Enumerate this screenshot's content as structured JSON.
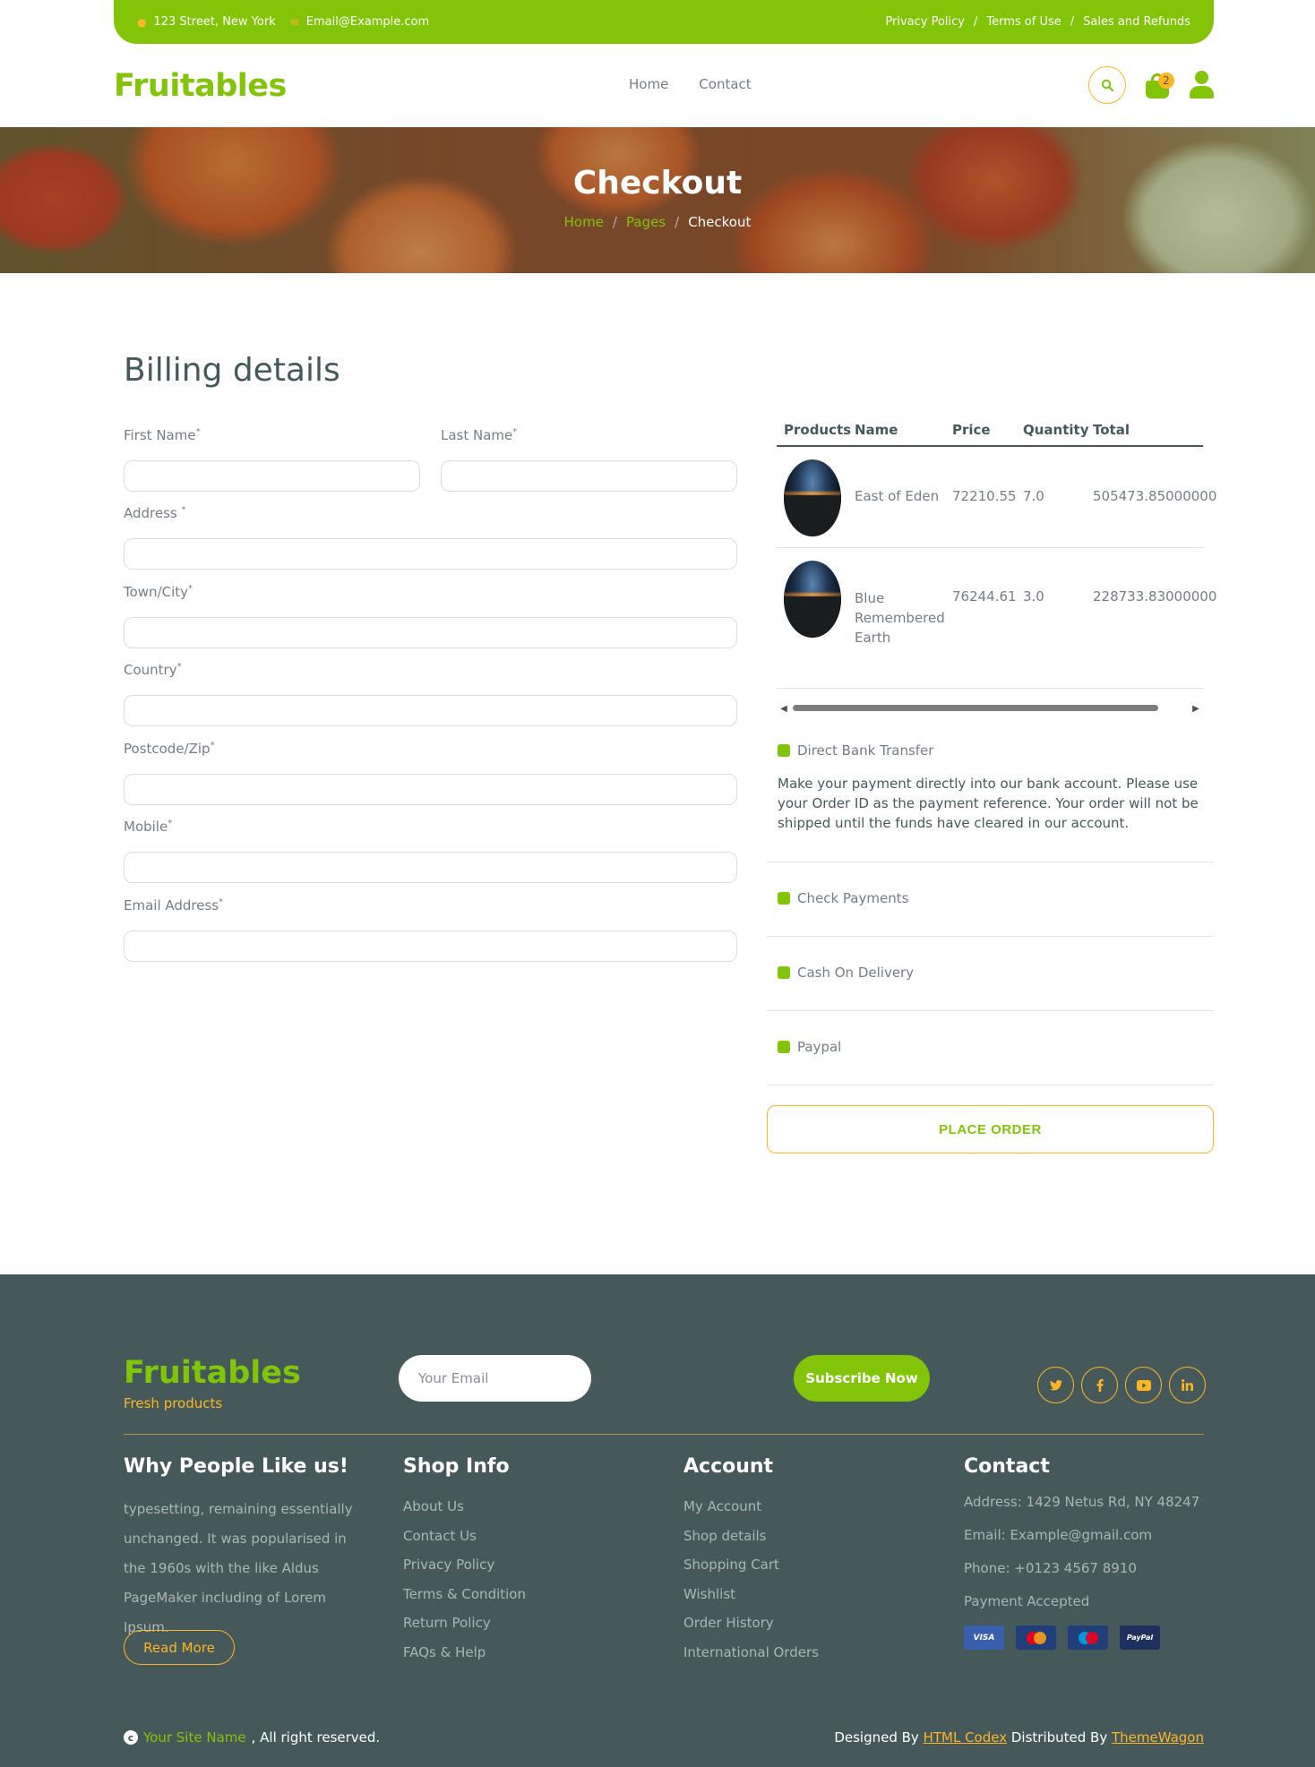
{
  "topbar": {
    "address": "123 Street, New York",
    "email": "Email@Example.com",
    "links": [
      "Privacy Policy",
      "Terms of Use",
      "Sales and Refunds"
    ],
    "separator": "/"
  },
  "navbar": {
    "logo": "Fruitables",
    "links": [
      "Home",
      "Contact"
    ],
    "cart_count": "2"
  },
  "hero": {
    "title": "Checkout",
    "breadcrumb": [
      "Home",
      "Pages",
      "Checkout"
    ],
    "separator": "/"
  },
  "billing": {
    "title": "Billing details",
    "fields": {
      "first_name": "First Name",
      "last_name": "Last Name",
      "address": "Address ",
      "town": "Town/City",
      "country": "Country",
      "postcode": "Postcode/Zip",
      "mobile": "Mobile",
      "email": "Email Address"
    },
    "required_mark": "*"
  },
  "order": {
    "headers": [
      "Products",
      "Name",
      "Price",
      "Quantity",
      "Total"
    ],
    "rows": [
      {
        "name": "East of Eden",
        "price": "72210.55",
        "quantity": "7.0",
        "total": "505473.85000000"
      },
      {
        "name": "Blue Remembered Earth",
        "price": "76244.61",
        "quantity": "3.0",
        "total": "228733.83000000"
      }
    ]
  },
  "payment": {
    "options": [
      "Direct Bank Transfer",
      "Check Payments",
      "Cash On Delivery",
      "Paypal"
    ],
    "description": "Make your payment directly into our bank account. Please use your Order ID as the payment reference. Your order will not be shipped until the funds have cleared in our account.",
    "place_order": "PLACE ORDER"
  },
  "footer": {
    "logo": "Fruitables",
    "tagline": "Fresh products",
    "email_placeholder": "Your Email",
    "subscribe": "Subscribe Now",
    "social": [
      "twitter-icon",
      "facebook-icon",
      "youtube-icon",
      "linkedin-icon"
    ],
    "why": {
      "title": "Why People Like us!",
      "text": "typesetting, remaining essentially unchanged. It was popularised in the 1960s with the like Aldus PageMaker including of Lorem Ipsum.",
      "button": "Read More"
    },
    "shop": {
      "title": "Shop Info",
      "links": [
        "About Us",
        "Contact Us",
        "Privacy Policy",
        "Terms & Condition",
        "Return Policy",
        "FAQs & Help"
      ]
    },
    "account": {
      "title": "Account",
      "links": [
        "My Account",
        "Shop details",
        "Shopping Cart",
        "Wishlist",
        "Order History",
        "International Orders"
      ]
    },
    "contact": {
      "title": "Contact",
      "address": "Address: 1429 Netus Rd, NY 48247",
      "email": "Email: Example@gmail.com",
      "phone": "Phone: +0123 4567 8910",
      "payment": "Payment Accepted",
      "cards": [
        "VISA",
        "MasterCard",
        "Maestro",
        "PayPal"
      ]
    },
    "copyright_icon": "c",
    "site_name": "Your Site Name",
    "rights": ", All right reserved.",
    "designed_by": "Designed By ",
    "designer": "HTML Codex",
    "distributed_by": " Distributed By ",
    "distributor": "ThemeWagon"
  },
  "colors": {
    "primary": "#81c408",
    "secondary": "#ffb524",
    "dark": "#45595b"
  }
}
